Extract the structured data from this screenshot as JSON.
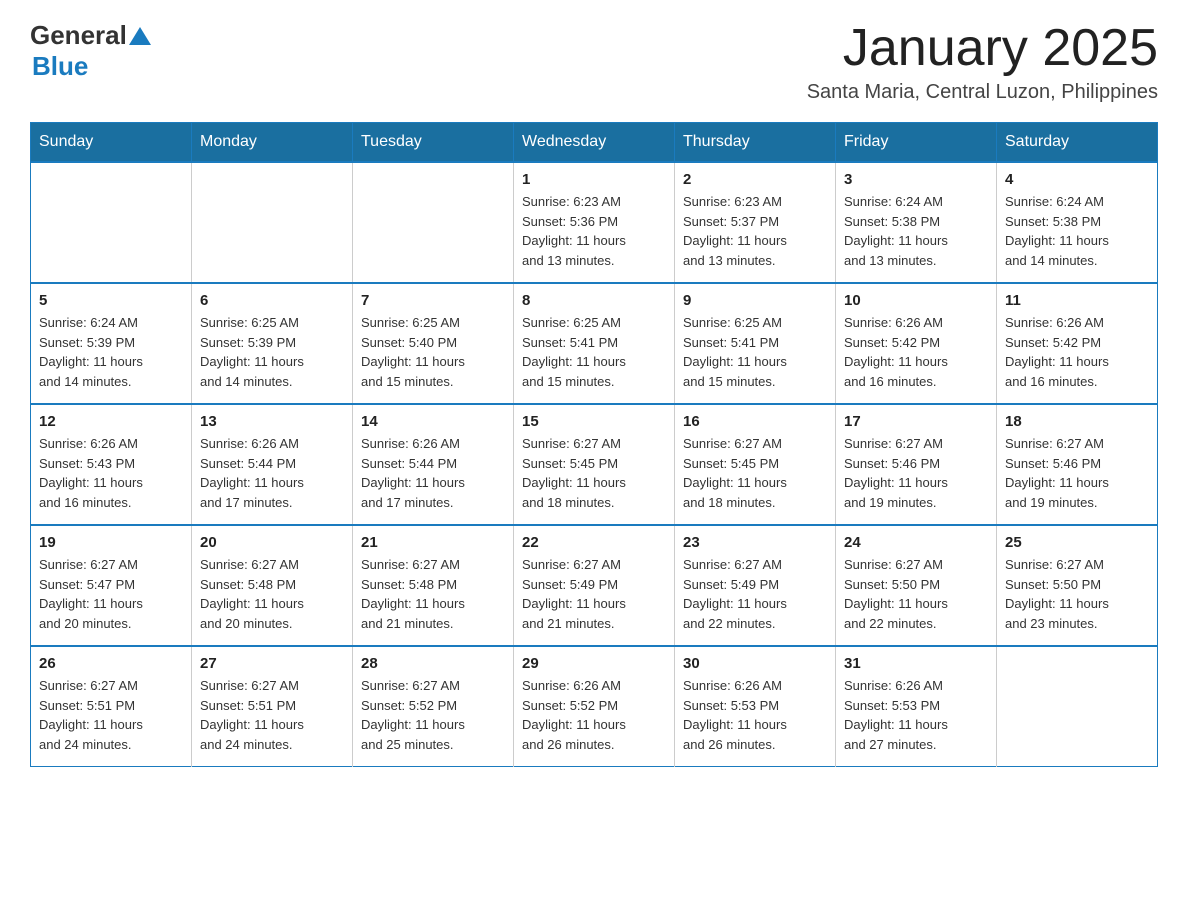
{
  "header": {
    "logo_general": "General",
    "logo_blue": "Blue",
    "month": "January 2025",
    "location": "Santa Maria, Central Luzon, Philippines"
  },
  "weekdays": [
    "Sunday",
    "Monday",
    "Tuesday",
    "Wednesday",
    "Thursday",
    "Friday",
    "Saturday"
  ],
  "weeks": [
    [
      {
        "day": "",
        "info": ""
      },
      {
        "day": "",
        "info": ""
      },
      {
        "day": "",
        "info": ""
      },
      {
        "day": "1",
        "info": "Sunrise: 6:23 AM\nSunset: 5:36 PM\nDaylight: 11 hours\nand 13 minutes."
      },
      {
        "day": "2",
        "info": "Sunrise: 6:23 AM\nSunset: 5:37 PM\nDaylight: 11 hours\nand 13 minutes."
      },
      {
        "day": "3",
        "info": "Sunrise: 6:24 AM\nSunset: 5:38 PM\nDaylight: 11 hours\nand 13 minutes."
      },
      {
        "day": "4",
        "info": "Sunrise: 6:24 AM\nSunset: 5:38 PM\nDaylight: 11 hours\nand 14 minutes."
      }
    ],
    [
      {
        "day": "5",
        "info": "Sunrise: 6:24 AM\nSunset: 5:39 PM\nDaylight: 11 hours\nand 14 minutes."
      },
      {
        "day": "6",
        "info": "Sunrise: 6:25 AM\nSunset: 5:39 PM\nDaylight: 11 hours\nand 14 minutes."
      },
      {
        "day": "7",
        "info": "Sunrise: 6:25 AM\nSunset: 5:40 PM\nDaylight: 11 hours\nand 15 minutes."
      },
      {
        "day": "8",
        "info": "Sunrise: 6:25 AM\nSunset: 5:41 PM\nDaylight: 11 hours\nand 15 minutes."
      },
      {
        "day": "9",
        "info": "Sunrise: 6:25 AM\nSunset: 5:41 PM\nDaylight: 11 hours\nand 15 minutes."
      },
      {
        "day": "10",
        "info": "Sunrise: 6:26 AM\nSunset: 5:42 PM\nDaylight: 11 hours\nand 16 minutes."
      },
      {
        "day": "11",
        "info": "Sunrise: 6:26 AM\nSunset: 5:42 PM\nDaylight: 11 hours\nand 16 minutes."
      }
    ],
    [
      {
        "day": "12",
        "info": "Sunrise: 6:26 AM\nSunset: 5:43 PM\nDaylight: 11 hours\nand 16 minutes."
      },
      {
        "day": "13",
        "info": "Sunrise: 6:26 AM\nSunset: 5:44 PM\nDaylight: 11 hours\nand 17 minutes."
      },
      {
        "day": "14",
        "info": "Sunrise: 6:26 AM\nSunset: 5:44 PM\nDaylight: 11 hours\nand 17 minutes."
      },
      {
        "day": "15",
        "info": "Sunrise: 6:27 AM\nSunset: 5:45 PM\nDaylight: 11 hours\nand 18 minutes."
      },
      {
        "day": "16",
        "info": "Sunrise: 6:27 AM\nSunset: 5:45 PM\nDaylight: 11 hours\nand 18 minutes."
      },
      {
        "day": "17",
        "info": "Sunrise: 6:27 AM\nSunset: 5:46 PM\nDaylight: 11 hours\nand 19 minutes."
      },
      {
        "day": "18",
        "info": "Sunrise: 6:27 AM\nSunset: 5:46 PM\nDaylight: 11 hours\nand 19 minutes."
      }
    ],
    [
      {
        "day": "19",
        "info": "Sunrise: 6:27 AM\nSunset: 5:47 PM\nDaylight: 11 hours\nand 20 minutes."
      },
      {
        "day": "20",
        "info": "Sunrise: 6:27 AM\nSunset: 5:48 PM\nDaylight: 11 hours\nand 20 minutes."
      },
      {
        "day": "21",
        "info": "Sunrise: 6:27 AM\nSunset: 5:48 PM\nDaylight: 11 hours\nand 21 minutes."
      },
      {
        "day": "22",
        "info": "Sunrise: 6:27 AM\nSunset: 5:49 PM\nDaylight: 11 hours\nand 21 minutes."
      },
      {
        "day": "23",
        "info": "Sunrise: 6:27 AM\nSunset: 5:49 PM\nDaylight: 11 hours\nand 22 minutes."
      },
      {
        "day": "24",
        "info": "Sunrise: 6:27 AM\nSunset: 5:50 PM\nDaylight: 11 hours\nand 22 minutes."
      },
      {
        "day": "25",
        "info": "Sunrise: 6:27 AM\nSunset: 5:50 PM\nDaylight: 11 hours\nand 23 minutes."
      }
    ],
    [
      {
        "day": "26",
        "info": "Sunrise: 6:27 AM\nSunset: 5:51 PM\nDaylight: 11 hours\nand 24 minutes."
      },
      {
        "day": "27",
        "info": "Sunrise: 6:27 AM\nSunset: 5:51 PM\nDaylight: 11 hours\nand 24 minutes."
      },
      {
        "day": "28",
        "info": "Sunrise: 6:27 AM\nSunset: 5:52 PM\nDaylight: 11 hours\nand 25 minutes."
      },
      {
        "day": "29",
        "info": "Sunrise: 6:26 AM\nSunset: 5:52 PM\nDaylight: 11 hours\nand 26 minutes."
      },
      {
        "day": "30",
        "info": "Sunrise: 6:26 AM\nSunset: 5:53 PM\nDaylight: 11 hours\nand 26 minutes."
      },
      {
        "day": "31",
        "info": "Sunrise: 6:26 AM\nSunset: 5:53 PM\nDaylight: 11 hours\nand 27 minutes."
      },
      {
        "day": "",
        "info": ""
      }
    ]
  ]
}
